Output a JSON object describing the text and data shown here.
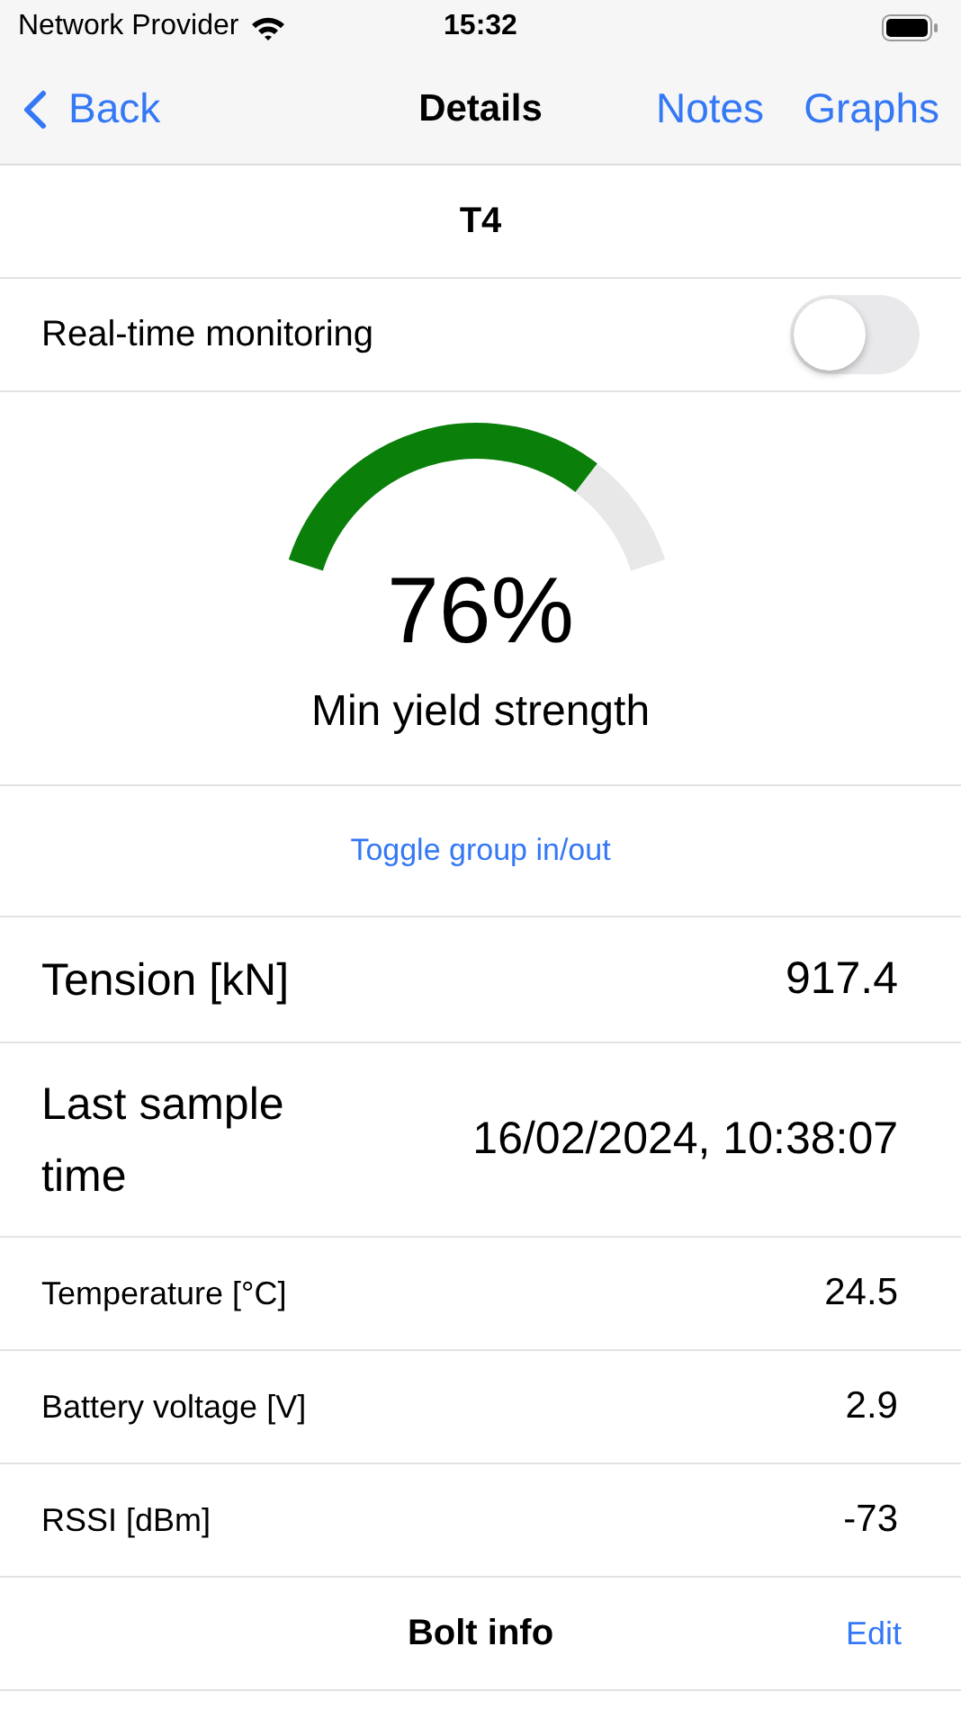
{
  "status_bar": {
    "carrier": "Network Provider",
    "time": "15:32"
  },
  "nav": {
    "back": "Back",
    "title": "Details",
    "actions": [
      "Notes",
      "Graphs"
    ]
  },
  "device": {
    "name": "T4"
  },
  "realtime": {
    "label": "Real-time monitoring",
    "on": false
  },
  "gauge": {
    "value": "76%",
    "label": "Min yield strength"
  },
  "toggle_link": "Toggle group in/out",
  "rows": [
    {
      "kind": "large",
      "label": "Tension [kN]",
      "value": "917.4"
    },
    {
      "kind": "large",
      "label": "Last sample time",
      "value": "16/02/2024, 10:38:07"
    },
    {
      "kind": "small",
      "label": "Temperature [°C]",
      "value": "24.5"
    },
    {
      "kind": "small",
      "label": "Battery voltage [V]",
      "value": "2.9"
    },
    {
      "kind": "small",
      "label": "RSSI [dBm]",
      "value": "-73"
    }
  ],
  "section": {
    "title": "Bolt info",
    "action": "Edit"
  }
}
